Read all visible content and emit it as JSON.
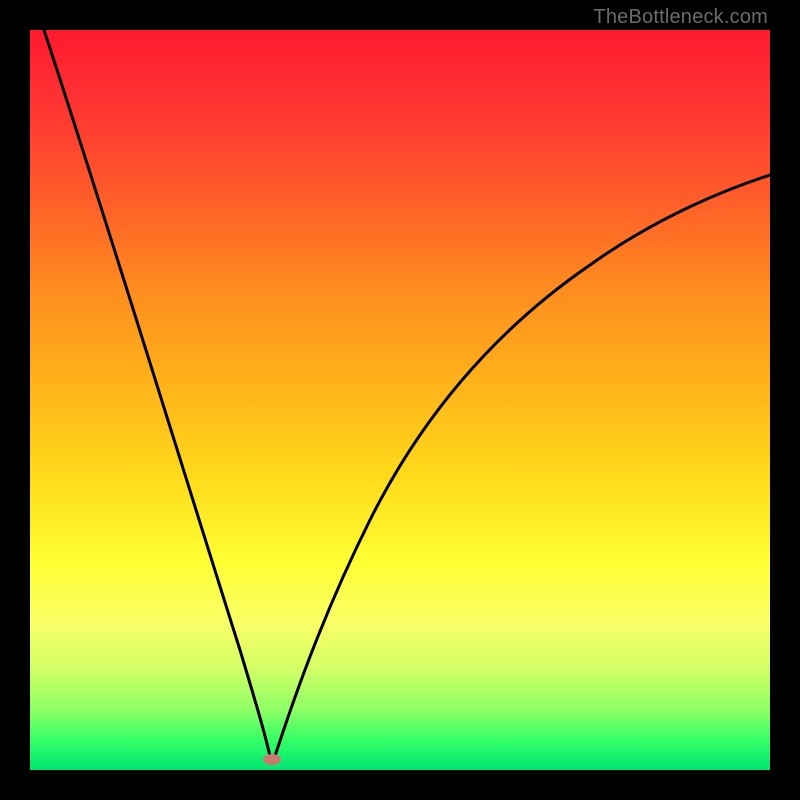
{
  "watermark": "TheBottleneck.com",
  "chart_data": {
    "type": "line",
    "title": "",
    "xlabel": "",
    "ylabel": "",
    "xlim": [
      0,
      100
    ],
    "ylim": [
      0,
      100
    ],
    "grid": false,
    "legend": false,
    "series": [
      {
        "name": "bottleneck-curve",
        "x": [
          2,
          10,
          20,
          25,
          30,
          32,
          33,
          34,
          36,
          40,
          50,
          60,
          70,
          80,
          90,
          100
        ],
        "y": [
          100,
          74,
          42,
          26,
          10,
          3,
          0,
          2,
          8,
          20,
          42,
          55,
          64,
          70,
          74,
          77
        ]
      }
    ],
    "annotations": [
      {
        "name": "optimal-point",
        "x": 32.7,
        "y": 0.5
      }
    ],
    "colors": {
      "curve": "#000000",
      "marker": "#c97a6f",
      "gradient_top": "#ff1a2e",
      "gradient_bottom": "#00e673"
    }
  }
}
